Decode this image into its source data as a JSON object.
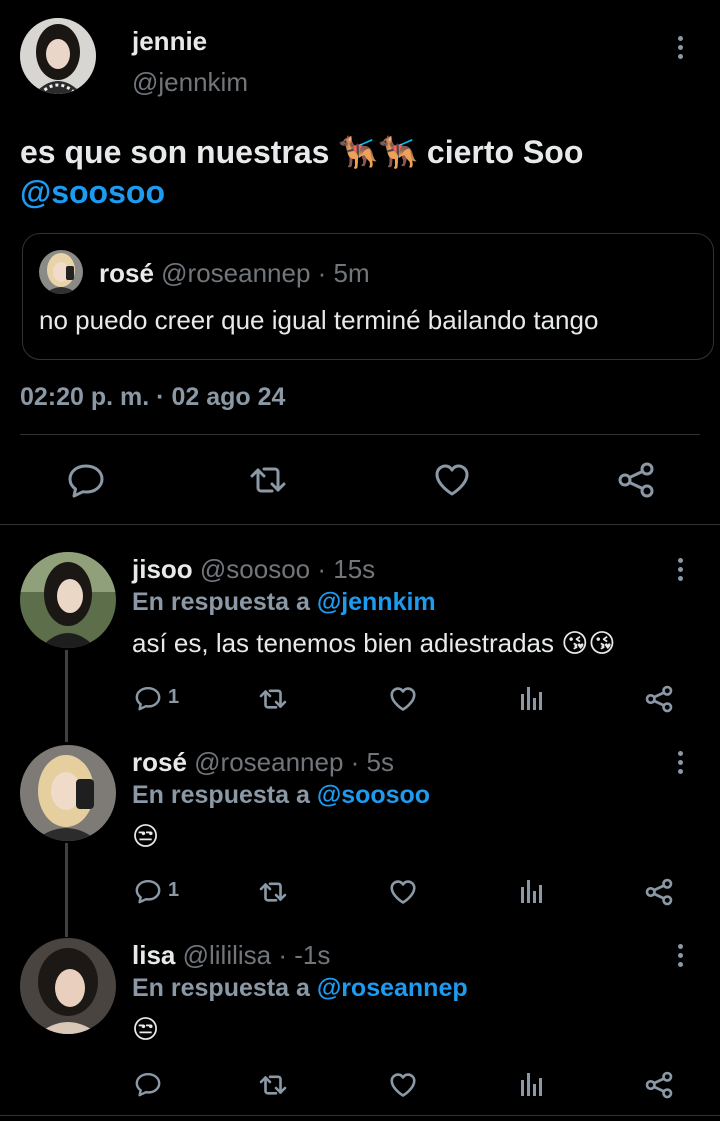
{
  "main_tweet": {
    "display_name": "jennie",
    "handle": "@jennkim",
    "text": "es que son nuestras",
    "emoji": "🐕‍🦺🐕‍🦺",
    "text_after": "cierto Soo",
    "mention": "@soosoo",
    "quoted": {
      "display_name": "rosé",
      "handle": "@roseannep",
      "time": "· 5m",
      "text": "no puedo creer que igual terminé bailando tango"
    },
    "timestamp": "02:20 p. m. · 02 ago 24"
  },
  "replies": [
    {
      "display_name": "jisoo",
      "handle": "@soosoo",
      "time": "· 15s",
      "reply_prefix": "En respuesta a",
      "reply_to": "@jennkim",
      "text": "así es, las tenemos bien adiestradas 😘😘",
      "reply_count": "1"
    },
    {
      "display_name": "rosé",
      "handle": "@roseannep",
      "time": "· 5s",
      "reply_prefix": "En respuesta a",
      "reply_to": "@soosoo",
      "text": "😒",
      "reply_count": "1"
    },
    {
      "display_name": "lisa",
      "handle": "@lililisa",
      "time": "· -1s",
      "reply_prefix": "En respuesta a",
      "reply_to": "@roseannep",
      "text": "😒",
      "reply_count": ""
    }
  ],
  "icons": [
    "more-vertical-icon",
    "reply-icon",
    "retweet-icon",
    "like-icon",
    "share-icon",
    "views-icon"
  ],
  "colors": {
    "background": "#000000",
    "text": "#e7e9ea",
    "muted": "#71767b",
    "accent": "#1d9bf0",
    "divider": "#2f3336"
  }
}
